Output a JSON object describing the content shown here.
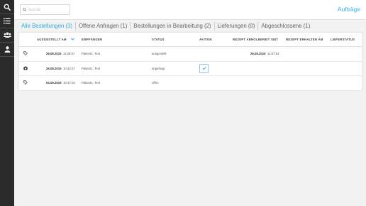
{
  "sidebar": {
    "items": [
      {
        "icon": "search-icon"
      },
      {
        "icon": "list-icon"
      },
      {
        "icon": "users-icon"
      },
      {
        "icon": "user-icon"
      }
    ]
  },
  "search": {
    "placeholder": "SUCHE"
  },
  "page_title": "Aufträge",
  "tabs": [
    {
      "label": "Alle Bestellungen (3)",
      "active": true
    },
    {
      "label": "Offene Anfragen (1)"
    },
    {
      "label": "Bestellungen in Bearbeitung (2)"
    },
    {
      "label": "Lieferungen (0)"
    },
    {
      "label": "Abgeschlossene (1)"
    }
  ],
  "table": {
    "columns": [
      "AUSGESTELLT AM",
      "EMPFÄNGER",
      "STATUS",
      "AKTION",
      "REZEPT ABHOLBEREIT SEIT",
      "REZEPT ERHALTEN AM",
      "LIEFERSTATUS"
    ],
    "sorted_column": "AUSGESTELLT AM",
    "rows": [
      {
        "icon": "tag-icon",
        "date": "26.08.2015",
        "time": "11:08:57",
        "recipient": "Patient1, Test",
        "status": "ausgestellt",
        "action": "",
        "ready_date": "26.08.2015",
        "ready_time": "11:07:53",
        "received": "",
        "delivery": ""
      },
      {
        "icon": "camera-icon",
        "date": "26.08.2015",
        "time": "10:42:07",
        "recipient": "Patient1, Test",
        "status": "angefragt",
        "action": "check-icon",
        "ready_date": "",
        "ready_time": "",
        "received": "",
        "delivery": ""
      },
      {
        "icon": "tag-icon",
        "date": "04.08.2015",
        "time": "10:47:04",
        "recipient": "Patient1, Test",
        "status": "offen",
        "action": "",
        "ready_date": "",
        "ready_time": "",
        "received": "",
        "delivery": ""
      }
    ]
  },
  "colors": {
    "accent": "#33aee0",
    "sidebar": "#2b2b2b"
  }
}
